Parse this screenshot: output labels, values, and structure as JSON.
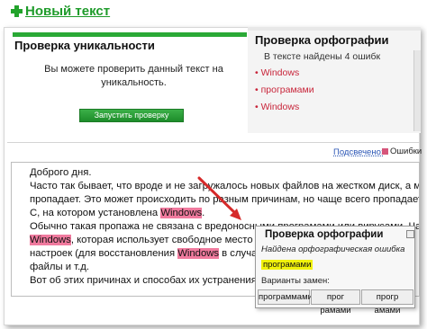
{
  "header": {
    "new_text_label": "Новый текст"
  },
  "uniqueness": {
    "title": "Проверка уникальности",
    "description": "Вы можете проверить данный текст на уникальность.",
    "button_label": "Запустить проверку"
  },
  "spelling": {
    "title": "Проверка орфографии",
    "found_text": "В тексте найдены 4 ошибк",
    "errors": [
      "Windows",
      "програмами",
      "Windows"
    ]
  },
  "legend": {
    "checked_label": "Подсвечено:",
    "error_label": "Ошибки"
  },
  "editor": {
    "lines": [
      [
        "Доброго дня."
      ],
      [
        "Часто так бывает, что вроде и не загружалось новых файлов на жестком диск, а место на не"
      ],
      [
        "пропадает. Это может происходить по разным причинам, но чаще всего пропадает на си"
      ],
      [
        "С, на котором установлена ",
        "Windows",
        "."
      ],
      [
        "Обычно такая пропажа не связана с вредоносными ",
        "програмами",
        " или вирусами. Чаще виной в"
      ],
      [
        "",
        "Windows",
        ", которая использует свободное место для разн"
      ],
      [
        "настроек (для восстановления ",
        "Windows",
        " в случае сбоя),"
      ],
      [
        "файлы и т.д."
      ],
      [
        "Вот об этих причинах и способах их устранения и погов"
      ]
    ]
  },
  "popup": {
    "title": "Проверка орфографии",
    "found_label": "Найдена орфографическая ошибка",
    "word": "програмами",
    "variants_label": "Варианты замен:",
    "variants": [
      "программами",
      "прог рамами",
      "прогр амами"
    ]
  },
  "colors": {
    "accent_green": "#1e9b2a",
    "error_pink": "#f07a9e",
    "arrow_red": "#d62a2a",
    "highlight_yellow": "#f1f20c"
  }
}
